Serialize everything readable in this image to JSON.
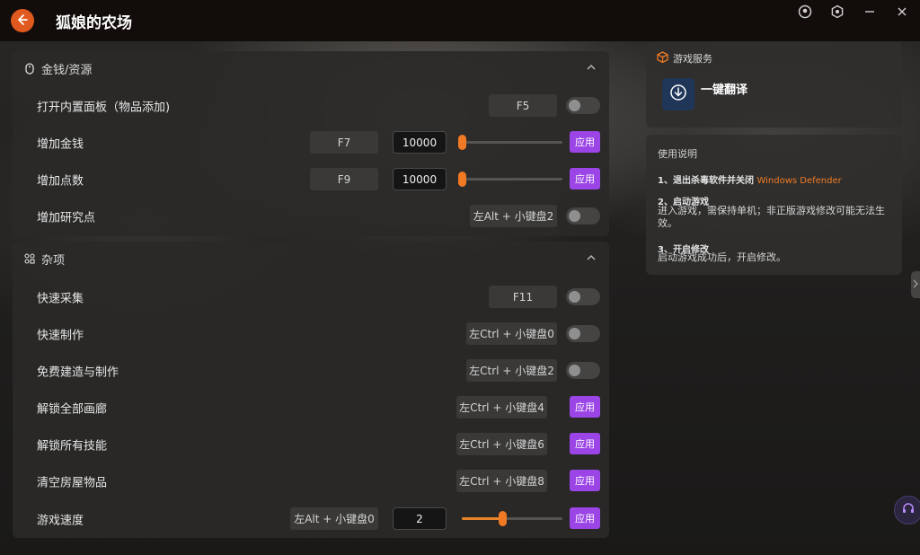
{
  "app": {
    "title": "狐娘的农场"
  },
  "colors": {
    "accent_orange": "#f07a24",
    "accent_purple": "#9b45e6",
    "panel": "#2a2928"
  },
  "icons": {
    "back": "back-arrow-icon",
    "profile": "profile-circle-icon",
    "settings": "settings-hex-icon",
    "minimize": "minimize-icon",
    "close": "close-icon",
    "mouse": "mouse-icon",
    "misc": "grid-icon",
    "service": "package-icon",
    "translate": "download-circle-icon",
    "support": "headset-icon"
  },
  "section_money": {
    "title": "金钱/资源",
    "rows": [
      {
        "label": "打开内置面板（物品添加)",
        "hotkey": "F5"
      },
      {
        "label": "增加金钱",
        "hotkey": "F7",
        "value": "10000",
        "slider_pct": 0,
        "apply": "应用"
      },
      {
        "label": "增加点数",
        "hotkey": "F9",
        "value": "10000",
        "slider_pct": 0,
        "apply": "应用"
      },
      {
        "label": "增加研究点",
        "hotkey": "左Alt + 小键盘2"
      }
    ]
  },
  "section_misc": {
    "title": "杂项",
    "rows": [
      {
        "label": "快速采集",
        "hotkey": "F11"
      },
      {
        "label": "快速制作",
        "hotkey": "左Ctrl + 小键盘0"
      },
      {
        "label": "免费建造与制作",
        "hotkey": "左Ctrl + 小键盘2"
      },
      {
        "label": "解锁全部画廊",
        "hotkey": "左Ctrl + 小键盘4",
        "apply": "应用"
      },
      {
        "label": "解锁所有技能",
        "hotkey": "左Ctrl + 小键盘6",
        "apply": "应用"
      },
      {
        "label": "清空房屋物品",
        "hotkey": "左Ctrl + 小键盘8",
        "apply": "应用"
      },
      {
        "label": "游戏速度",
        "hotkey": "左Alt + 小键盘0",
        "value": "2",
        "slider_pct": 40,
        "apply": "应用"
      }
    ]
  },
  "service": {
    "title": "游戏服务",
    "translate_label": "一键翻译"
  },
  "instructions": {
    "title": "使用说明",
    "step1_title": "1、退出杀毒软件并关闭",
    "step1_highlight": "Windows Defender",
    "step2_title": "2、启动游戏",
    "step2_body": "进入游戏，需保持单机；非正版游戏修改可能无法生效。",
    "step3_title": "3、开启修改",
    "step3_body": "启动游戏成功后，开启修改。"
  }
}
